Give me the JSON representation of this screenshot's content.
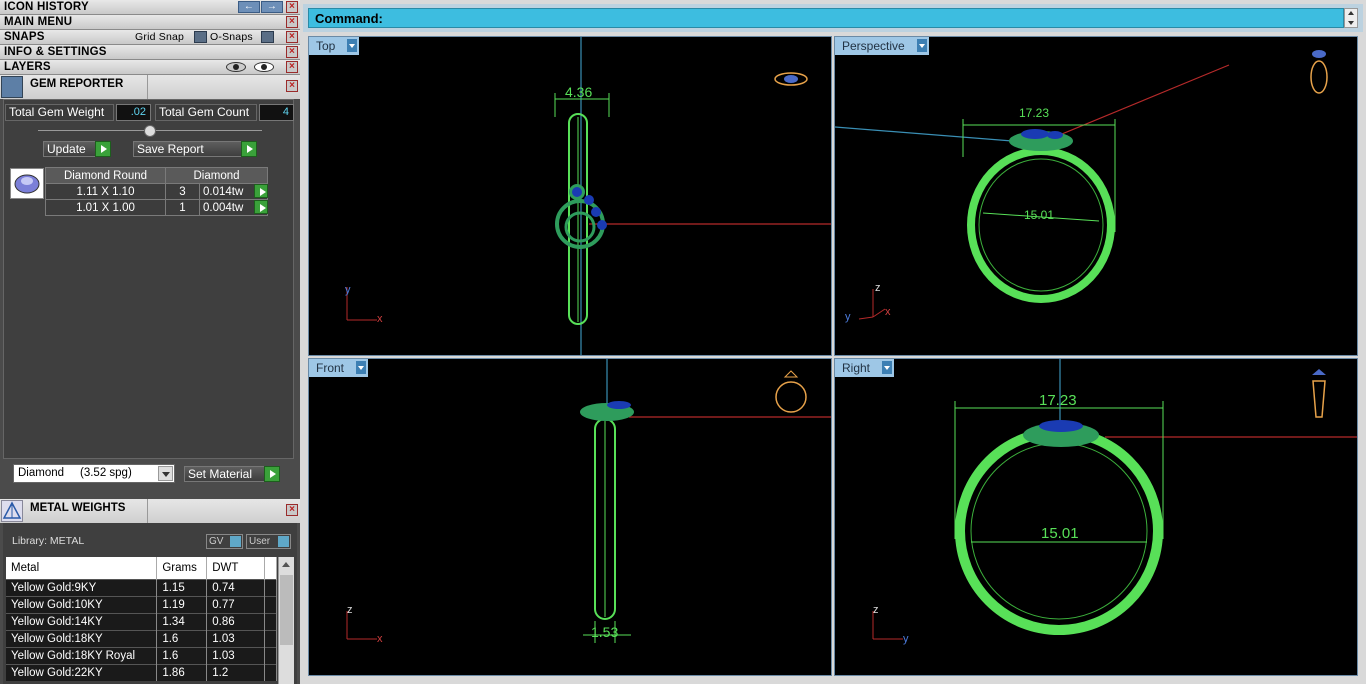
{
  "left_panel": {
    "icon_history": "ICON HISTORY",
    "main_menu": "MAIN MENU",
    "snaps": "SNAPS",
    "grid_snap": "Grid Snap",
    "o_snaps": "O-Snaps",
    "info_settings": "INFO & SETTINGS",
    "layers": "LAYERS"
  },
  "gem_reporter": {
    "title": "GEM REPORTER",
    "total_weight_label": "Total Gem Weight",
    "total_weight_value": ".02",
    "total_count_label": "Total Gem Count",
    "total_count_value": "4",
    "update_label": "Update",
    "save_report_label": "Save Report",
    "table": {
      "headers": [
        "Diamond Round",
        "Diamond"
      ],
      "rows": [
        {
          "size": "1.11 X 1.10",
          "count": "3",
          "weight": "0.014tw"
        },
        {
          "size": "1.01 X 1.00",
          "count": "1",
          "weight": "0.004tw"
        }
      ]
    },
    "material_select": "Diamond     (3.52 spg)",
    "set_material_label": "Set Material"
  },
  "metal_weights": {
    "title": "METAL WEIGHTS",
    "library_label": "Library: METAL",
    "gv_label": "GV",
    "user_label": "User",
    "headers": [
      "Metal",
      "Grams",
      "DWT"
    ],
    "rows": [
      [
        "Yellow Gold:9KY",
        "1.15",
        "0.74"
      ],
      [
        "Yellow Gold:10KY",
        "1.19",
        "0.77"
      ],
      [
        "Yellow Gold:14KY",
        "1.34",
        "0.86"
      ],
      [
        "Yellow Gold:18KY",
        "1.6",
        "1.03"
      ],
      [
        "Yellow Gold:18KY Royal",
        "1.6",
        "1.03"
      ],
      [
        "Yellow Gold:22KY",
        "1.86",
        "1.2"
      ]
    ]
  },
  "command": {
    "label": "Command:"
  },
  "viewports": {
    "top": {
      "label": "Top",
      "dim": "4.36"
    },
    "perspective": {
      "label": "Perspective",
      "dim_outer": "17.23",
      "dim_inner": "15.01"
    },
    "front": {
      "label": "Front",
      "dim": "1.53"
    },
    "right": {
      "label": "Right",
      "dim_outer": "17.23",
      "dim_inner": "15.01"
    }
  },
  "colors": {
    "ring": "#58e058",
    "gem": "#1a3bb3",
    "cmd": "#3dbde0"
  }
}
